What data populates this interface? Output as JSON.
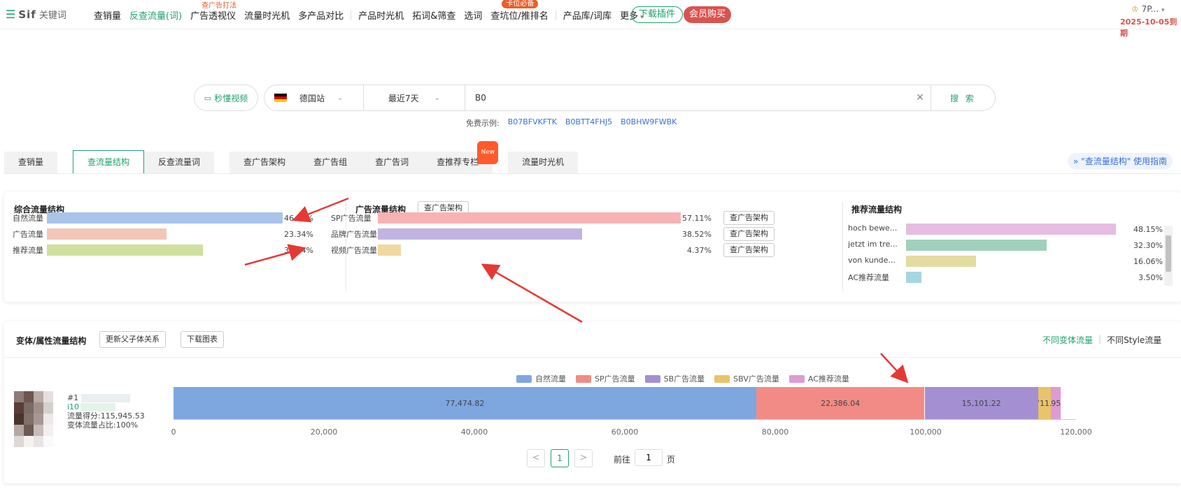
{
  "brand": {
    "name": "Sif",
    "sub": "关键词"
  },
  "nav": {
    "items": [
      "查销量",
      "反查流量(词)",
      "广告透视仪",
      "流量时光机",
      "多产品对比",
      "产品时光机",
      "拓词&筛查",
      "选词",
      "查坑位/推排名",
      "产品库/词库",
      "更多"
    ],
    "badge_ads": "查广告打法",
    "badge_rank": "卡位必备",
    "download": "下载插件",
    "vip": "会员购买",
    "user": "7P...",
    "expire": "2025-10-05到期"
  },
  "search": {
    "video_btn": "秒懂视频",
    "country": "德国站",
    "range": "最近7天",
    "query": "B0",
    "button": "搜 索",
    "examples_label": "免费示例:",
    "examples": [
      "B07BFVKFTK",
      "B0BTT4FHJ5",
      "B0BHW9FWBK"
    ]
  },
  "tabs": [
    "查销量",
    "查流量结构",
    "反查流量词",
    "查广告架构",
    "查广告组",
    "查广告词",
    "查推荐专栏",
    "流量时光机"
  ],
  "tab_new": "New",
  "guide": "\"查流量结构\" 使用指南",
  "overall": {
    "title": "综合流量结构",
    "rows": [
      {
        "label": "自然流量",
        "pct": "46.12%",
        "value": 46.12,
        "color": "#a9c4ea"
      },
      {
        "label": "广告流量",
        "pct": "23.34%",
        "value": 23.34,
        "color": "#f3c6b8"
      },
      {
        "label": "推荐流量",
        "pct": "30.54%",
        "value": 30.54,
        "color": "#cfe09c"
      }
    ]
  },
  "ads": {
    "title": "广告流量结构",
    "check_btn": "查广告架构",
    "row_btn": "查广告架构",
    "rows": [
      {
        "label": "SP广告流量",
        "pct": "57.11%",
        "value": 57.11,
        "color": "#f7b3b3"
      },
      {
        "label": "品牌广告流量",
        "pct": "38.52%",
        "value": 38.52,
        "color": "#c3b3e2"
      },
      {
        "label": "视频广告流量",
        "pct": "4.37%",
        "value": 4.37,
        "color": "#efd9a0"
      }
    ]
  },
  "rec": {
    "title": "推荐流量结构",
    "rows": [
      {
        "label": "hoch bewe...",
        "pct": "48.15%",
        "value": 48.15,
        "color": "#e6bde0"
      },
      {
        "label": "jetzt im tre...",
        "pct": "32.30%",
        "value": 32.3,
        "color": "#9fd1bd"
      },
      {
        "label": "von kunde...",
        "pct": "16.06%",
        "value": 16.06,
        "color": "#e2dca0"
      },
      {
        "label": "AC推荐流量",
        "pct": "3.50%",
        "value": 3.5,
        "color": "#a6d7de"
      }
    ]
  },
  "variant": {
    "title": "变体/属性流量结构",
    "update_btn": "更新父子体关系",
    "download_btn": "下载图表",
    "switch_a": "不同变体流量",
    "switch_b": "不同Style流量",
    "product": {
      "rank": "#1",
      "asin": "i10",
      "score": "流量得分:115,945.53",
      "share": "变体流量占比:100%"
    }
  },
  "chart_data": {
    "type": "bar",
    "orientation": "horizontal",
    "stacked": true,
    "categories": [
      "#1"
    ],
    "series": [
      {
        "name": "自然流量",
        "values": [
          77474.82
        ],
        "color": "#7ea7e0",
        "label": "77,474.82"
      },
      {
        "name": "SP广告流量",
        "values": [
          22386.04
        ],
        "color": "#f28b85",
        "label": "22,386.04"
      },
      {
        "name": "SB广告流量",
        "values": [
          15101.22
        ],
        "color": "#a48fd3",
        "label": "15,101.22"
      },
      {
        "name": "SBV广告流量",
        "values": [
          1711.79
        ],
        "color": "#e8c46a",
        "label": "1,711.79"
      },
      {
        "name": "AC推荐流量",
        "values": [
          1295.99
        ],
        "color": "#df9ad4",
        "label": "1,295.99"
      }
    ],
    "xlim": [
      0,
      120000
    ],
    "xticks": [
      "0",
      "20,000",
      "40,000",
      "60,000",
      "80,000",
      "100,000",
      "120,000"
    ],
    "legend": "top-center"
  },
  "pager": {
    "prev": "<",
    "current": "1",
    "next": ">",
    "goto": "前往",
    "goto_value": "1",
    "page": "页"
  }
}
